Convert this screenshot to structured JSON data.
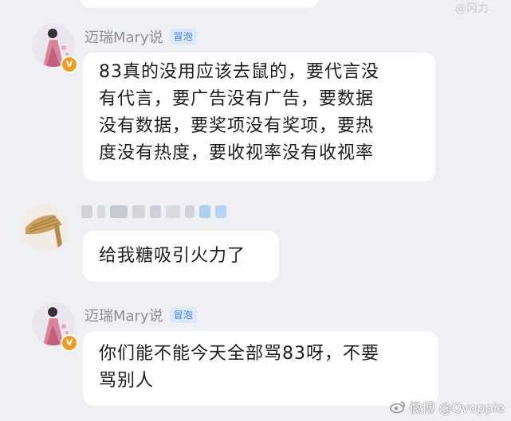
{
  "messages": [
    {
      "sender": "迈瑞Mary说",
      "tag": "冒泡",
      "verified_badge": "V",
      "lines": [
        "83真的没用应该去鼠的，要代言没",
        "有代言，要广告没有广告，要数据",
        "没有数据，要奖项没有奖项，要热",
        "度没有热度，要收视率没有收视率"
      ]
    },
    {
      "sender": "",
      "lines": [
        "给我糖吸引火力了"
      ]
    },
    {
      "sender": "迈瑞Mary说",
      "tag": "冒泡",
      "verified_badge": "V",
      "lines": [
        "你们能不能今天全部骂83呀，不要",
        "骂别人"
      ]
    }
  ],
  "watermark": {
    "top": "@冈力",
    "bottom": "微博 @Qvoppie"
  },
  "colors": {
    "background": "#eef0f3",
    "bubble": "#ffffff",
    "sender_name": "#8a8f99",
    "tag_text": "#3b7fe0",
    "tag_bg": "#dde9fb",
    "verified": "#f39a1e"
  }
}
